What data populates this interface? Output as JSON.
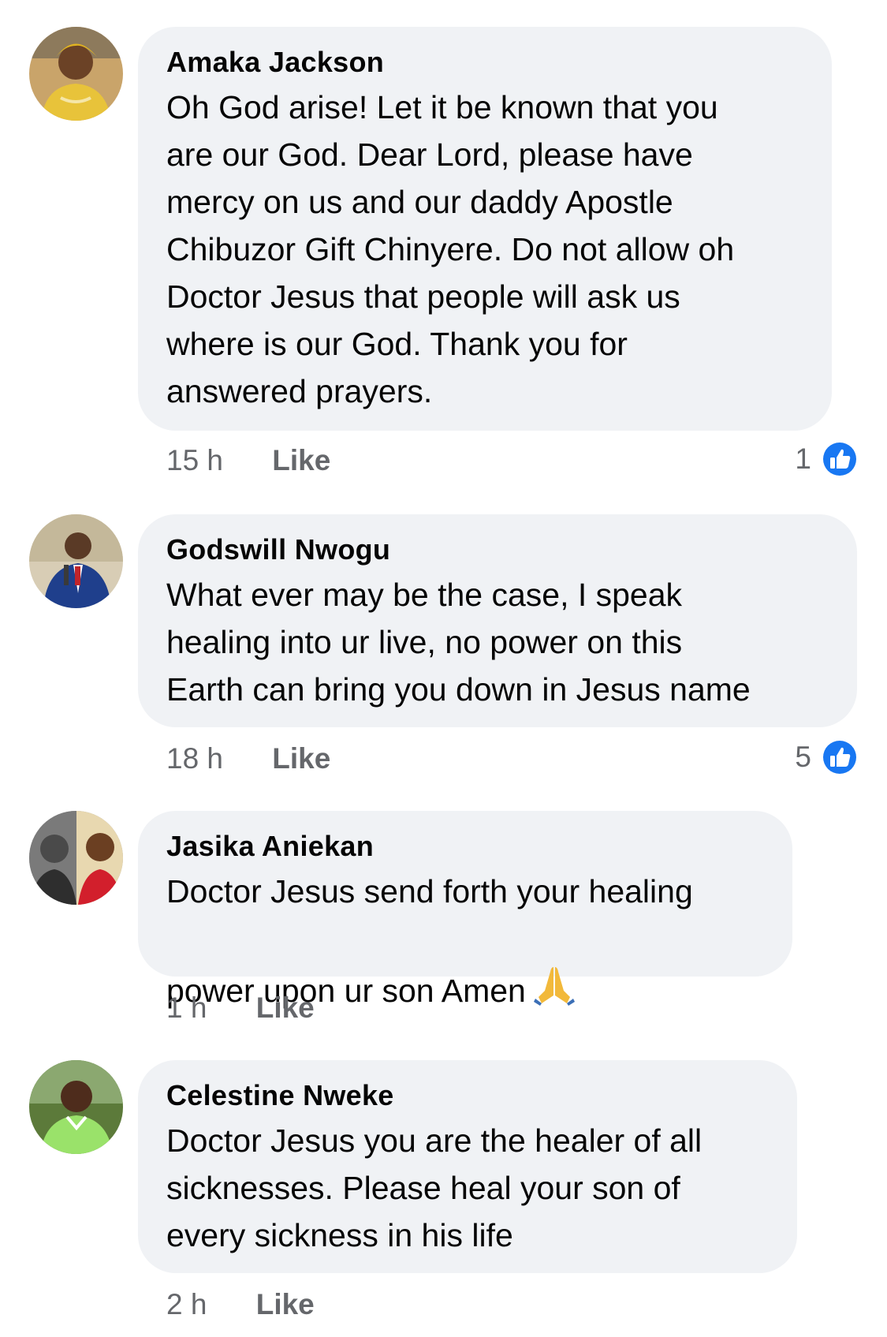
{
  "comments": [
    {
      "author": "Amaka Jackson",
      "text": "Oh God arise! Let it be known that you\nare our God. Dear Lord, please have\nmercy on us and our daddy Apostle\nChibuzor Gift Chinyere. Do not allow oh\nDoctor Jesus that people will ask us\nwhere is our God. Thank you for\nanswered prayers.",
      "time": "15 h",
      "like_label": "Like",
      "reaction_count": "1"
    },
    {
      "author": "Godswill Nwogu",
      "text": "What ever may be the case, I speak\nhealing into ur live, no power on this\nEarth can bring you down  in Jesus name",
      "time": "18 h",
      "like_label": "Like",
      "reaction_count": "5"
    },
    {
      "author": "Jasika Aniekan",
      "text": "Doctor Jesus send forth your healing\npower upon ur son Amen",
      "time": "1 h",
      "like_label": "Like",
      "emoji": "🙏"
    },
    {
      "author": "Celestine Nweke",
      "text": "Doctor Jesus you are the healer of all\nsicknesses. Please heal your son of\nevery sickness in his life",
      "time": "2 h",
      "like_label": "Like"
    }
  ],
  "colors": {
    "bubble": "#f0f2f5",
    "meta_text": "#65676b",
    "like_blue": "#1877f2"
  },
  "icons": {
    "reaction": "thumbs-up-icon",
    "emoji": "folded-hands-emoji"
  }
}
